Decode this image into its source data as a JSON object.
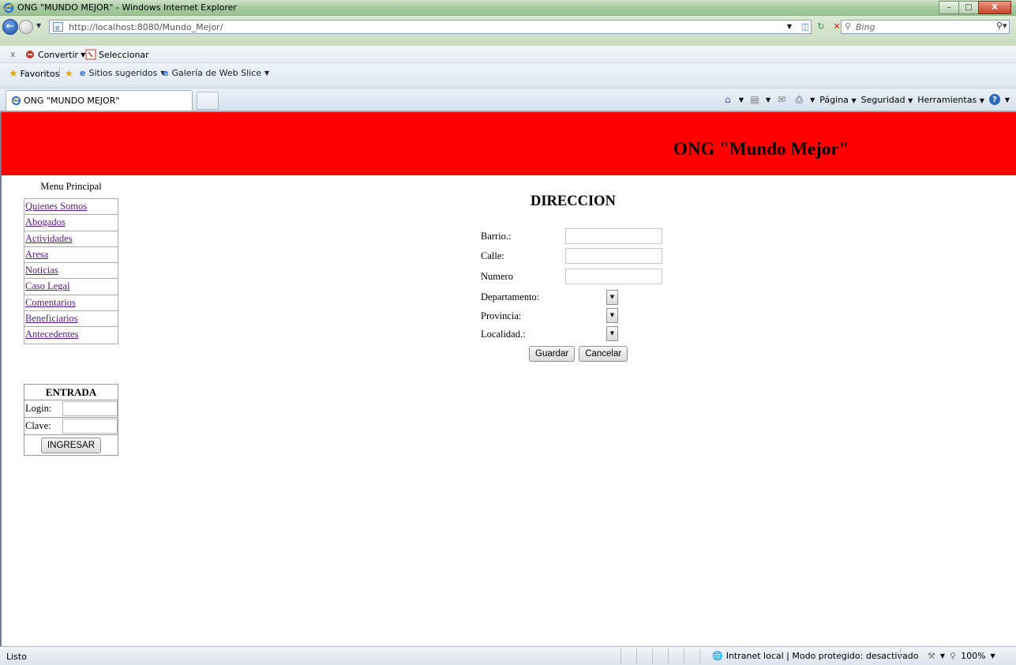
{
  "window": {
    "title": "ONG \"MUNDO MEJOR\" - Windows Internet Explorer"
  },
  "address_bar": {
    "url": "http://localhost:8080/Mundo_Mejor/",
    "search_placeholder": "Bing"
  },
  "command_bar_1": {
    "close": "x",
    "convert_label": "Convertir",
    "select_label": "Seleccionar"
  },
  "favorites_bar": {
    "favorites_label": "Favoritos",
    "items": [
      "Sitios sugeridos",
      "Galería de Web Slice"
    ]
  },
  "tabs": {
    "active_tab_label": "ONG \"MUNDO MEJOR\""
  },
  "command_bar_2": {
    "page_label": "Página",
    "security_label": "Seguridad",
    "tools_label": "Herramientas"
  },
  "banner": {
    "title": "ONG \"Mundo Mejor\"",
    "background_color": "#ff0000"
  },
  "menu": {
    "title": "Menu Principal",
    "items": [
      "Quienes Somos",
      "Abogados",
      "Actividades",
      "Aresa",
      "Noticias",
      "Caso Legal",
      "Comentarios",
      "Beneficiarios",
      "Antecedentes"
    ]
  },
  "login": {
    "title": "ENTRADA",
    "login_label": "Login:",
    "password_label": "Clave:",
    "submit_label": "INGRESAR"
  },
  "address_form": {
    "title": "DIRECCION",
    "barrio_label": "Barrio.:",
    "calle_label": "Calle:",
    "numero_label": "Numero",
    "departamento_label": "Departamento:",
    "provincia_label": "Provincia:",
    "localidad_label": "Localidad.:",
    "save_label": "Guardar",
    "cancel_label": "Cancelar"
  },
  "status_bar": {
    "status": "Listo",
    "zone": "Intranet local | Modo protegido: desactivado",
    "zoom": "100%"
  }
}
